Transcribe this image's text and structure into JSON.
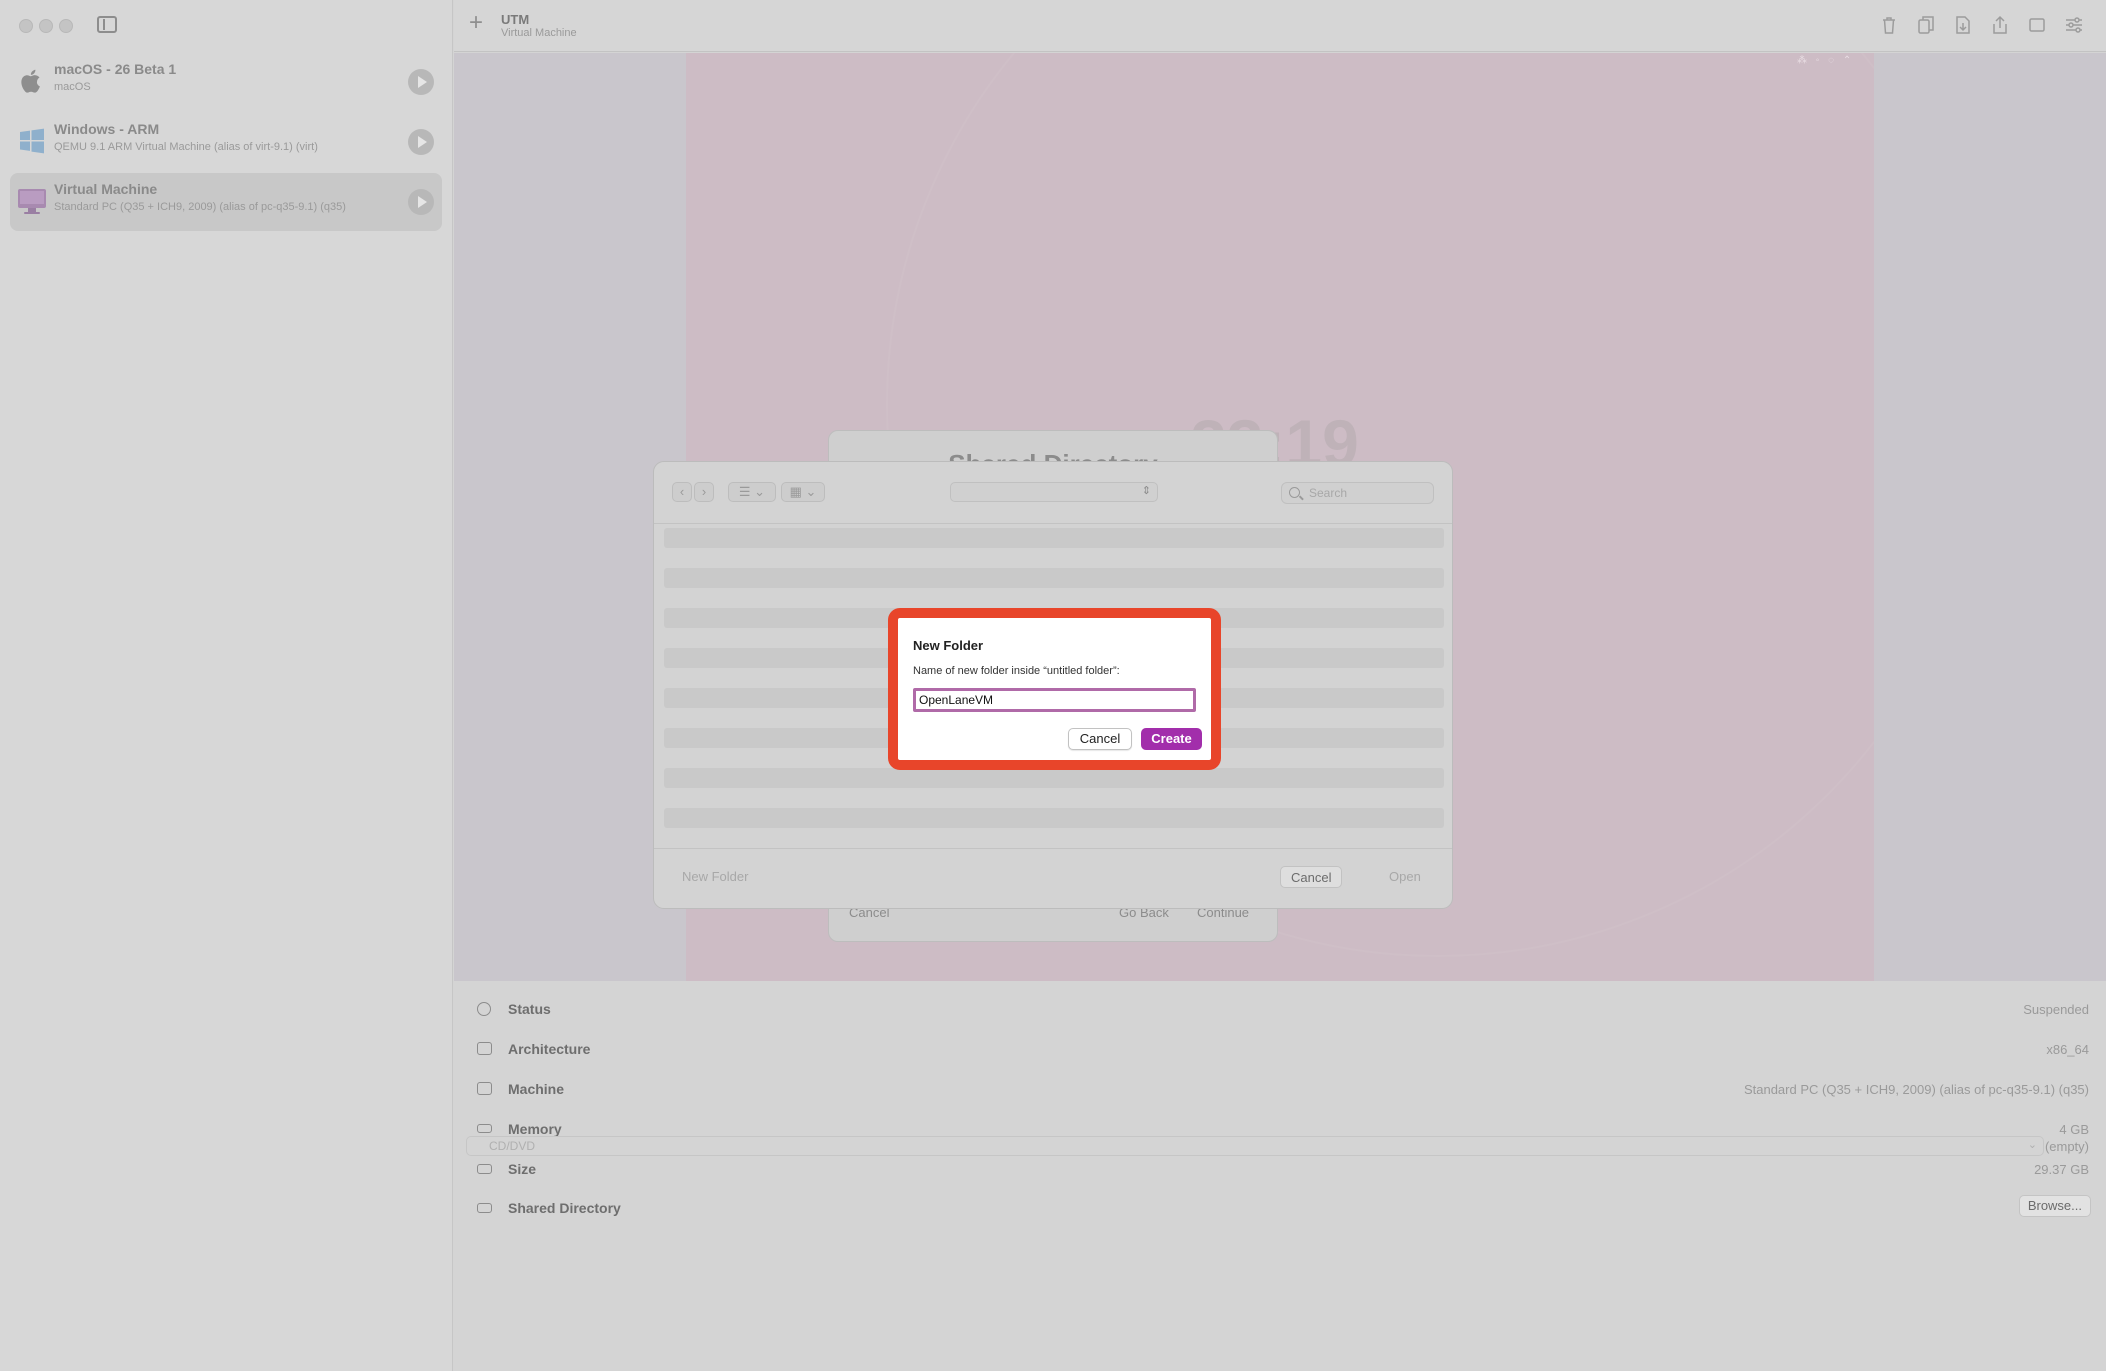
{
  "app": {
    "title": "UTM",
    "subtitle": "Virtual Machine"
  },
  "sidebar": {
    "items": [
      {
        "name": "macOS - 26 Beta 1",
        "subtitle": "macOS",
        "icon": "apple-icon"
      },
      {
        "name": "Windows - ARM",
        "subtitle": "QEMU 9.1 ARM Virtual Machine (alias of virt-9.1) (virt)",
        "icon": "windows-icon"
      },
      {
        "name": "Virtual Machine",
        "subtitle": "Standard PC (Q35 + ICH9, 2009) (alias of pc-q35-9.1) (q35)",
        "icon": "monitor-icon",
        "selected": true
      }
    ]
  },
  "vm_screen": {
    "clock": "23:19"
  },
  "wizard": {
    "title": "Shared Directory",
    "cancel": "Cancel",
    "go_back": "Go Back",
    "continue": "Continue"
  },
  "open_panel": {
    "search_placeholder": "Search",
    "new_folder": "New Folder",
    "cancel": "Cancel",
    "open": "Open"
  },
  "new_folder_dialog": {
    "title": "New Folder",
    "label": "Name of new folder inside “untitled folder”:",
    "value": "OpenLaneVM",
    "cancel": "Cancel",
    "create": "Create"
  },
  "details": {
    "rows": [
      {
        "label": "Status",
        "value": "Suspended",
        "icon": "info-icon"
      },
      {
        "label": "Architecture",
        "value": "x86_64",
        "icon": "cpu-icon"
      },
      {
        "label": "Machine",
        "value": "Standard PC (Q35 + ICH9, 2009) (alias of pc-q35-9.1) (q35)",
        "icon": "display-icon"
      },
      {
        "label": "Memory",
        "value": "4 GB",
        "icon": "memory-icon"
      },
      {
        "label": "Size",
        "value": "29.37 GB",
        "icon": "drive-icon"
      },
      {
        "label": "Shared Directory",
        "value": "",
        "icon": "shared-drive-icon"
      }
    ],
    "browse": "Browse...",
    "cd_label": "CD/DVD",
    "cd_value": "(empty)"
  },
  "colors": {
    "accent": "#a22eab",
    "highlight": "#e8452a"
  }
}
